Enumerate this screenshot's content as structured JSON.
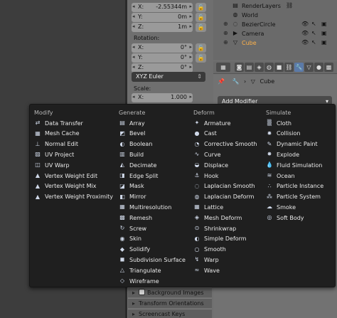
{
  "npanel": {
    "location_fields": [
      {
        "axis": "X:",
        "value": "-2.55344m"
      },
      {
        "axis": "Y:",
        "value": "0m"
      },
      {
        "axis": "Z:",
        "value": "1m"
      }
    ],
    "rotation_label": "Rotation:",
    "rotation_fields": [
      {
        "axis": "X:",
        "value": "0°"
      },
      {
        "axis": "Y:",
        "value": "0°"
      },
      {
        "axis": "Z:",
        "value": "0°"
      }
    ],
    "rotation_mode": "XYZ Euler",
    "scale_label": "Scale:",
    "scale_fields": [
      {
        "axis": "X:",
        "value": "1.000"
      }
    ],
    "sections": [
      {
        "label": "Background Images"
      },
      {
        "label": "Transform Orientations"
      },
      {
        "label": "Screencast Keys"
      }
    ]
  },
  "outliner": {
    "rows": [
      {
        "name": "RenderLayers"
      },
      {
        "name": "World"
      },
      {
        "name": "BezierCircle"
      },
      {
        "name": "Camera"
      },
      {
        "name": "Cube"
      }
    ]
  },
  "properties": {
    "object_name": "Cube",
    "add_modifier_label": "Add Modifier"
  },
  "menu": {
    "columns": [
      {
        "heading": "Modify",
        "items": [
          "Data Transfer",
          "Mesh Cache",
          "Normal Edit",
          "UV Project",
          "UV Warp",
          "Vertex Weight Edit",
          "Vertex Weight Mix",
          "Vertex Weight Proximity"
        ],
        "icons": [
          "transfer-icon",
          "cache-icon",
          "normal-icon",
          "uvproject-icon",
          "uvwarp-icon",
          "weight-edit-icon",
          "weight-mix-icon",
          "weight-proximity-icon"
        ]
      },
      {
        "heading": "Generate",
        "items": [
          "Array",
          "Bevel",
          "Boolean",
          "Build",
          "Decimate",
          "Edge Split",
          "Mask",
          "Mirror",
          "Multiresolution",
          "Remesh",
          "Screw",
          "Skin",
          "Solidify",
          "Subdivision Surface",
          "Triangulate",
          "Wireframe"
        ],
        "icons": [
          "array-icon",
          "bevel-icon",
          "boolean-icon",
          "build-icon",
          "decimate-icon",
          "edgesplit-icon",
          "mask-icon",
          "mirror-icon",
          "multires-icon",
          "remesh-icon",
          "screw-icon",
          "skin-icon",
          "solidify-icon",
          "subsurf-icon",
          "triangulate-icon",
          "wireframe-icon"
        ]
      },
      {
        "heading": "Deform",
        "items": [
          "Armature",
          "Cast",
          "Corrective Smooth",
          "Curve",
          "Displace",
          "Hook",
          "Laplacian Smooth",
          "Laplacian Deform",
          "Lattice",
          "Mesh Deform",
          "Shrinkwrap",
          "Simple Deform",
          "Smooth",
          "Warp",
          "Wave"
        ],
        "icons": [
          "armature-icon",
          "cast-icon",
          "corrective-smooth-icon",
          "curve-icon",
          "displace-icon",
          "hook-icon",
          "laplacian-smooth-icon",
          "laplacian-deform-icon",
          "lattice-icon",
          "mesh-deform-icon",
          "shrinkwrap-icon",
          "simple-deform-icon",
          "smooth-icon",
          "warp-icon",
          "wave-icon"
        ]
      },
      {
        "heading": "Simulate",
        "items": [
          "Cloth",
          "Collision",
          "Dynamic Paint",
          "Explode",
          "Fluid Simulation",
          "Ocean",
          "Particle Instance",
          "Particle System",
          "Smoke",
          "Soft Body"
        ],
        "icons": [
          "cloth-icon",
          "collision-icon",
          "dynamic-paint-icon",
          "explode-icon",
          "fluid-icon",
          "ocean-icon",
          "particle-instance-icon",
          "particle-system-icon",
          "smoke-icon",
          "softbody-icon"
        ]
      }
    ]
  }
}
